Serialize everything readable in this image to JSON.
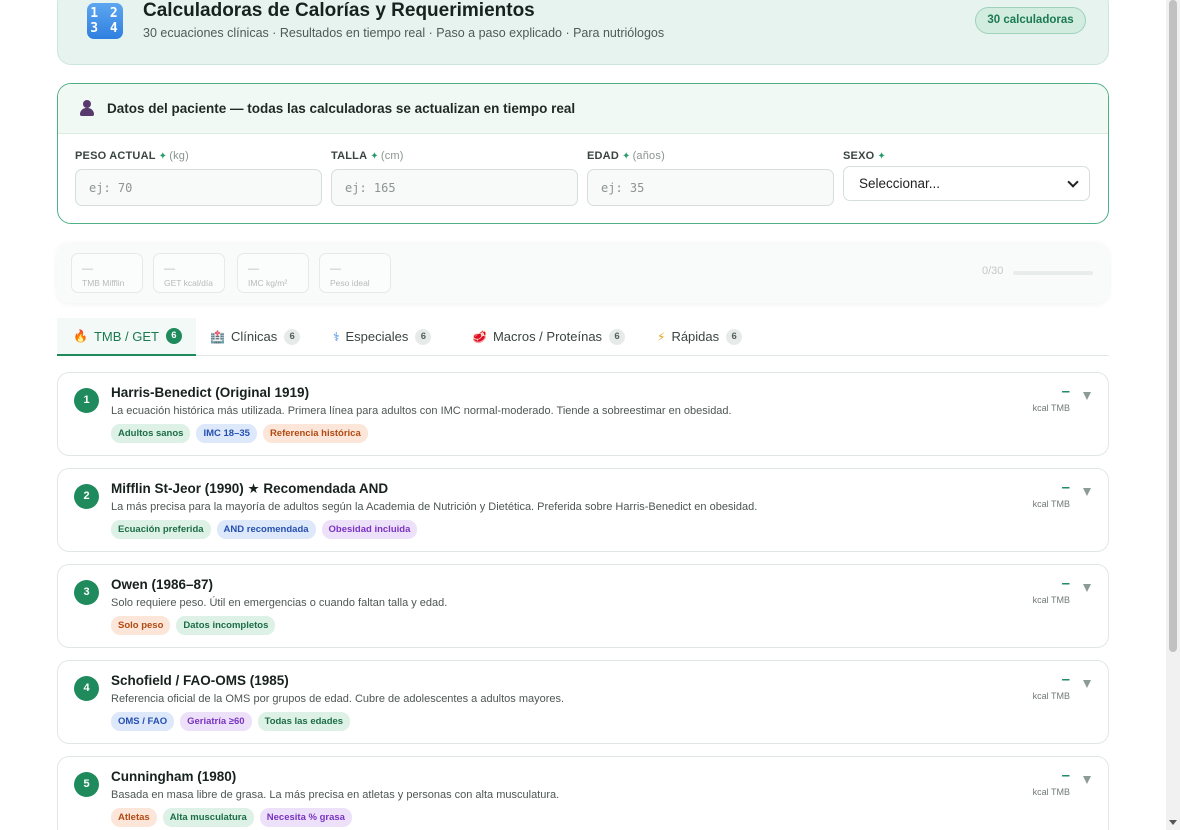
{
  "header": {
    "title": "Calculadoras de Calorías y Requerimientos",
    "subtitle": "30 ecuaciones clínicas · Resultados en tiempo real · Paso a paso explicado · Para nutriólogos",
    "badge": "30 calculadoras",
    "icon_text_top": "1 2",
    "icon_text_bottom": "3 4"
  },
  "patient": {
    "title": "Datos del paciente — todas las calculadoras se actualizan en tiempo real",
    "fields": [
      {
        "label": "PESO ACTUAL",
        "unit": "(kg)",
        "placeholder": "ej: 70"
      },
      {
        "label": "TALLA",
        "unit": "(cm)",
        "placeholder": "ej: 165"
      },
      {
        "label": "EDAD",
        "unit": "(años)",
        "placeholder": "ej: 35"
      },
      {
        "label": "SEXO",
        "unit": "",
        "selected": "Seleccionar..."
      }
    ],
    "star": "✦"
  },
  "summary": {
    "stats": [
      {
        "value": "—",
        "label": "TMB Mifflin"
      },
      {
        "value": "—",
        "label": "GET kcal/día"
      },
      {
        "value": "—",
        "label": "IMC kg/m²"
      },
      {
        "value": "—",
        "label": "Peso ideal"
      }
    ],
    "progress_text": "0/30",
    "progress_fraction": 0
  },
  "tabs": [
    {
      "icon": "🔥",
      "label": "TMB / GET",
      "count": "6"
    },
    {
      "icon": "🏥",
      "label": "Clínicas",
      "count": "6"
    },
    {
      "icon": "⚕",
      "label": "Especiales",
      "count": "6"
    },
    {
      "icon": "🥩",
      "label": "Macros / Proteínas",
      "count": "6"
    },
    {
      "icon": "⚡",
      "label": "Rápidas",
      "count": "6"
    }
  ],
  "calculators": [
    {
      "number": "1",
      "title": "Harris-Benedict (Original 1919)",
      "description": "La ecuación histórica más utilizada. Primera línea para adultos con IMC normal-moderado. Tiende a sobreestimar en obesidad.",
      "tags": [
        {
          "text": "Adultos sanos",
          "color": "green"
        },
        {
          "text": "IMC 18–35",
          "color": "blue"
        },
        {
          "text": "Referencia histórica",
          "color": "orange"
        }
      ],
      "result": "–",
      "unit": "kcal TMB"
    },
    {
      "number": "2",
      "title": "Mifflin St-Jeor (1990) ★ Recomendada AND",
      "description": "La más precisa para la mayoría de adultos según la Academia de Nutrición y Dietética. Preferida sobre Harris-Benedict en obesidad.",
      "tags": [
        {
          "text": "Ecuación preferida",
          "color": "green"
        },
        {
          "text": "AND recomendada",
          "color": "blue"
        },
        {
          "text": "Obesidad incluida",
          "color": "purple"
        }
      ],
      "result": "–",
      "unit": "kcal TMB"
    },
    {
      "number": "3",
      "title": "Owen (1986–87)",
      "description": "Solo requiere peso. Útil en emergencias o cuando faltan talla y edad.",
      "tags": [
        {
          "text": "Solo peso",
          "color": "orange"
        },
        {
          "text": "Datos incompletos",
          "color": "green"
        }
      ],
      "result": "–",
      "unit": "kcal TMB"
    },
    {
      "number": "4",
      "title": "Schofield / FAO-OMS (1985)",
      "description": "Referencia oficial de la OMS por grupos de edad. Cubre de adolescentes a adultos mayores.",
      "tags": [
        {
          "text": "OMS / FAO",
          "color": "blue"
        },
        {
          "text": "Geriatría ≥60",
          "color": "purple"
        },
        {
          "text": "Todas las edades",
          "color": "green"
        }
      ],
      "result": "–",
      "unit": "kcal TMB"
    },
    {
      "number": "5",
      "title": "Cunningham (1980)",
      "description": "Basada en masa libre de grasa. La más precisa en atletas y personas con alta musculatura.",
      "tags": [
        {
          "text": "Atletas",
          "color": "orange"
        },
        {
          "text": "Alta musculatura",
          "color": "green"
        },
        {
          "text": "Necesita % grasa",
          "color": "purple"
        }
      ],
      "result": "–",
      "unit": "kcal TMB"
    }
  ]
}
